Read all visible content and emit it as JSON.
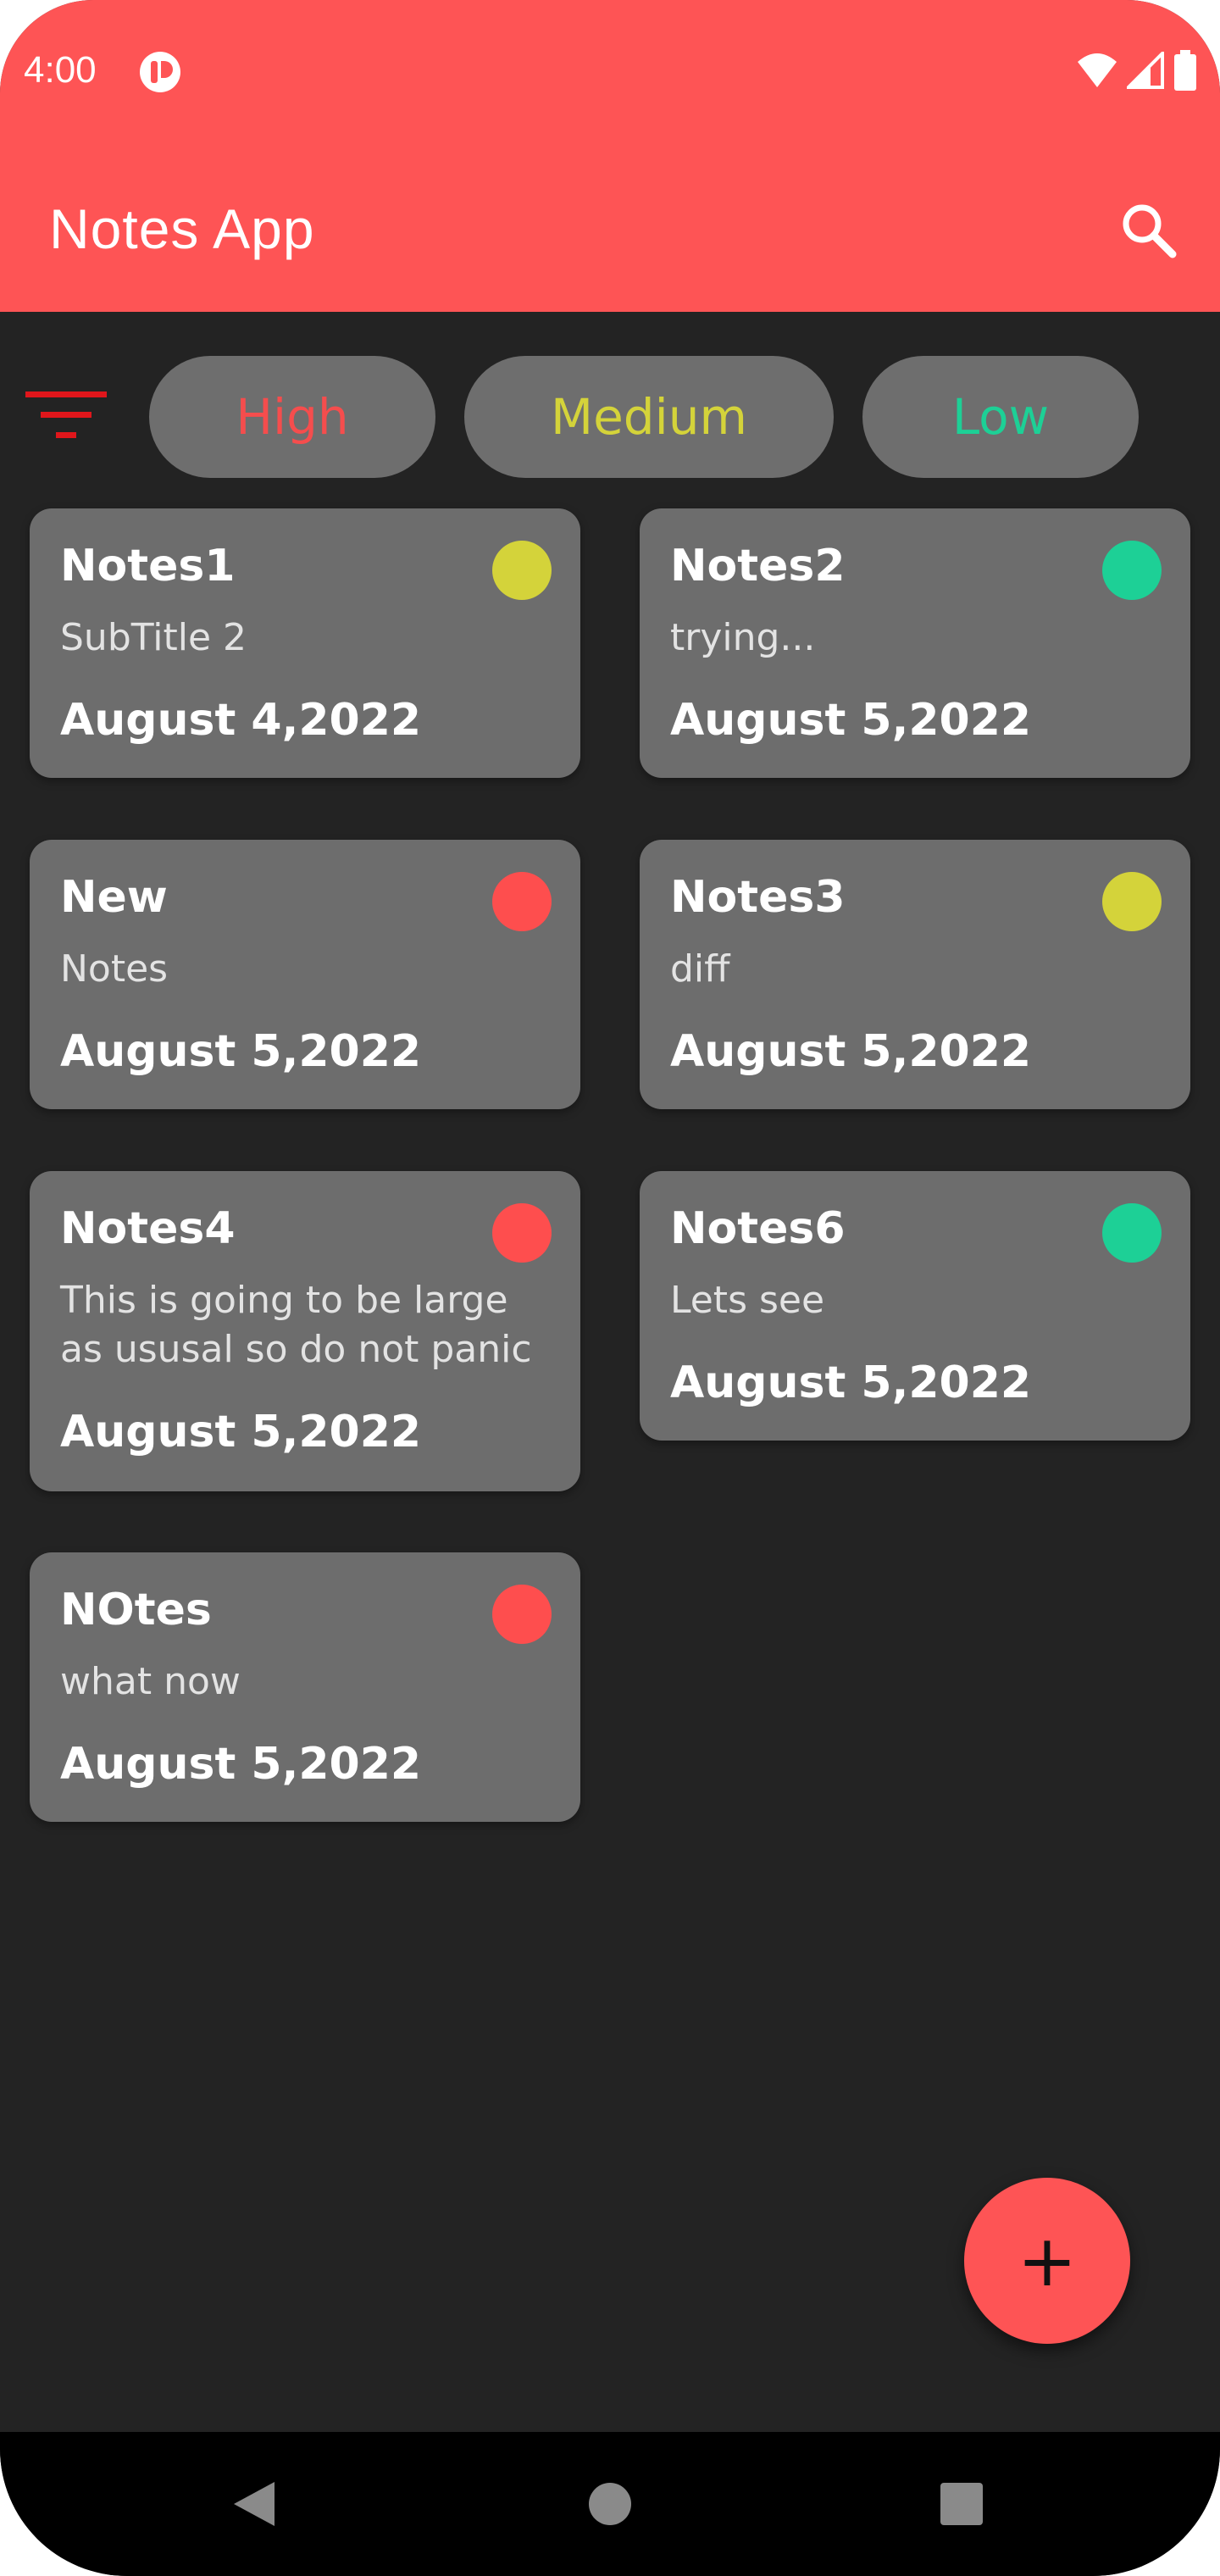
{
  "status_bar": {
    "time": "4:00",
    "icons": [
      "app-notification-icon",
      "wifi-icon",
      "cell-signal-icon",
      "battery-icon"
    ]
  },
  "app_bar": {
    "title": "Notes App",
    "search_icon": "search-icon"
  },
  "filters": {
    "filter_icon": "filter-icon",
    "chips": [
      {
        "label": "High",
        "color": "#f54d4d"
      },
      {
        "label": "Medium",
        "color": "#d4d33a"
      },
      {
        "label": "Low",
        "color": "#1dd096"
      }
    ]
  },
  "notes": [
    {
      "title": "Notes1",
      "subtitle": "SubTitle 2",
      "date": "August 4,2022",
      "priority_color": "#d4d33a"
    },
    {
      "title": "Notes2",
      "subtitle": "trying...",
      "date": "August 5,2022",
      "priority_color": "#1dd096"
    },
    {
      "title": "New",
      "subtitle": "Notes",
      "date": "August 5,2022",
      "priority_color": "#fe4e4e"
    },
    {
      "title": "Notes3",
      "subtitle": "diff",
      "date": "August 5,2022",
      "priority_color": "#d4d33a"
    },
    {
      "title": "Notes4",
      "subtitle": "This is going to be large as ususal so do not panic",
      "date": "August 5,2022",
      "priority_color": "#fe4e4e"
    },
    {
      "title": "Notes6",
      "subtitle": "Lets see",
      "date": "August 5,2022",
      "priority_color": "#1dd096"
    },
    {
      "title": "NOtes",
      "subtitle": "what now",
      "date": "August 5,2022",
      "priority_color": "#fe4e4e"
    }
  ],
  "fab": {
    "label": "+",
    "icon": "add-icon"
  },
  "nav_bar": {
    "buttons": [
      "back-icon",
      "home-icon",
      "recents-icon"
    ]
  },
  "colors": {
    "accent": "#fe5455",
    "background": "#232323",
    "card": "#6d6d6d",
    "chip": "#6e6e6e"
  }
}
